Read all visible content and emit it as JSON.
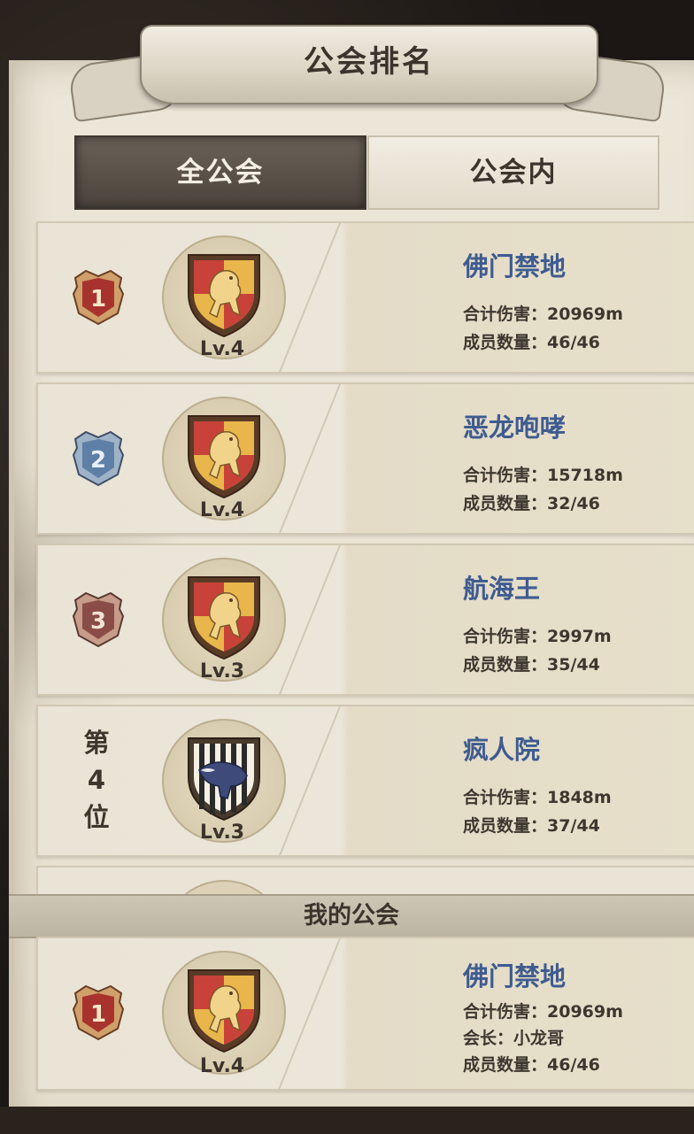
{
  "title": "公会排名",
  "tabs": [
    {
      "label": "全公会",
      "active": true
    },
    {
      "label": "公会内",
      "active": false
    }
  ],
  "rankings": [
    {
      "rank": "1",
      "rank_style": "badge-gold",
      "name": "佛门禁地",
      "level": "Lv.4",
      "emblem": "lion-crest-icon",
      "damage": "合计伤害：20969m",
      "members": "成员数量：46/46"
    },
    {
      "rank": "2",
      "rank_style": "badge-silver",
      "name": "恶龙咆哮",
      "level": "Lv.4",
      "emblem": "lion-crest-icon",
      "damage": "合计伤害：15718m",
      "members": "成员数量：32/46"
    },
    {
      "rank": "3",
      "rank_style": "badge-bronze",
      "name": "航海王",
      "level": "Lv.3",
      "emblem": "lion-crest-icon",
      "damage": "合计伤害：2997m",
      "members": "成员数量：35/44"
    },
    {
      "rank_label": [
        "第",
        "4",
        "位"
      ],
      "rank_style": "text",
      "name": "疯人院",
      "level": "Lv.3",
      "emblem": "badger-crest-icon",
      "damage": "合计伤害：1848m",
      "members": "成员数量：37/44"
    }
  ],
  "my_guild_header": "我的公会",
  "my_guild": {
    "rank": "1",
    "rank_style": "badge-gold",
    "name": "佛门禁地",
    "level": "Lv.4",
    "emblem": "lion-crest-icon",
    "damage": "合计伤害：20969m",
    "leader": "会长：小龙哥",
    "members": "成员数量：46/46"
  },
  "colors": {
    "guild_name": "#3f5c90",
    "panel": "#e9e3d4",
    "tab_active": "#4c443c",
    "gold_crest": "#e8b64a",
    "red_crest": "#c8423a"
  }
}
